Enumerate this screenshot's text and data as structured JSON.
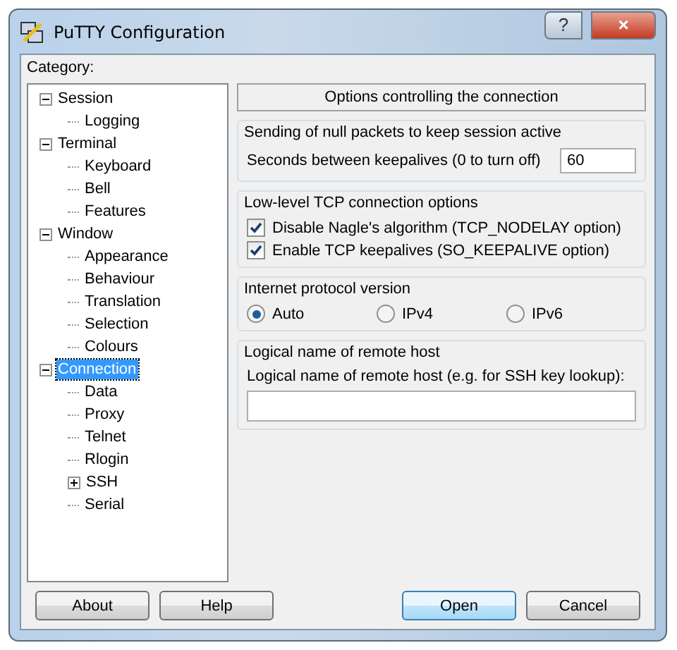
{
  "window": {
    "title": "PuTTY Configuration",
    "buttons": [
      "?",
      "×"
    ]
  },
  "category_label": "Category:",
  "tree": [
    {
      "label": "Session",
      "expanded": true,
      "selected": false,
      "children": [
        {
          "label": "Logging",
          "selected": false
        }
      ]
    },
    {
      "label": "Terminal",
      "expanded": true,
      "selected": false,
      "children": [
        {
          "label": "Keyboard",
          "selected": false
        },
        {
          "label": "Bell",
          "selected": false
        },
        {
          "label": "Features",
          "selected": false
        }
      ]
    },
    {
      "label": "Window",
      "expanded": true,
      "selected": false,
      "children": [
        {
          "label": "Appearance",
          "selected": false
        },
        {
          "label": "Behaviour",
          "selected": false
        },
        {
          "label": "Translation",
          "selected": false
        },
        {
          "label": "Selection",
          "selected": false
        },
        {
          "label": "Colours",
          "selected": false
        }
      ]
    },
    {
      "label": "Connection",
      "expanded": true,
      "selected": true,
      "children": [
        {
          "label": "Data",
          "selected": false
        },
        {
          "label": "Proxy",
          "selected": false
        },
        {
          "label": "Telnet",
          "selected": false
        },
        {
          "label": "Rlogin",
          "selected": false
        },
        {
          "label": "SSH",
          "expanded": false,
          "selected": false
        },
        {
          "label": "Serial",
          "selected": false
        }
      ]
    }
  ],
  "panel_header": "Options controlling the connection",
  "groups": [
    {
      "title": "Sending of null packets to keep session active",
      "items": [
        {
          "kind": "number",
          "label": "Seconds between keepalives (0 to turn off)",
          "value": "60"
        }
      ]
    },
    {
      "title": "Low-level TCP connection options",
      "items": [
        {
          "kind": "checkbox",
          "label": "Disable Nagle's algorithm (TCP_NODELAY option)",
          "checked": true
        },
        {
          "kind": "checkbox",
          "label": "Enable TCP keepalives (SO_KEEPALIVE option)",
          "checked": true
        }
      ]
    },
    {
      "title": "Internet protocol version",
      "items": [
        {
          "kind": "radios",
          "options": [
            {
              "label": "Auto",
              "selected": true
            },
            {
              "label": "IPv4",
              "selected": false
            },
            {
              "label": "IPv6",
              "selected": false
            }
          ]
        }
      ]
    },
    {
      "title": "Logical name of remote host",
      "items": [
        {
          "kind": "text",
          "label": "Logical name of remote host (e.g. for SSH key lookup):"
        }
      ]
    }
  ],
  "buttons": [
    {
      "label": "About",
      "default": false
    },
    {
      "label": "Help",
      "default": false
    },
    {
      "label": "Open",
      "default": true
    },
    {
      "label": "Cancel",
      "default": false
    }
  ]
}
